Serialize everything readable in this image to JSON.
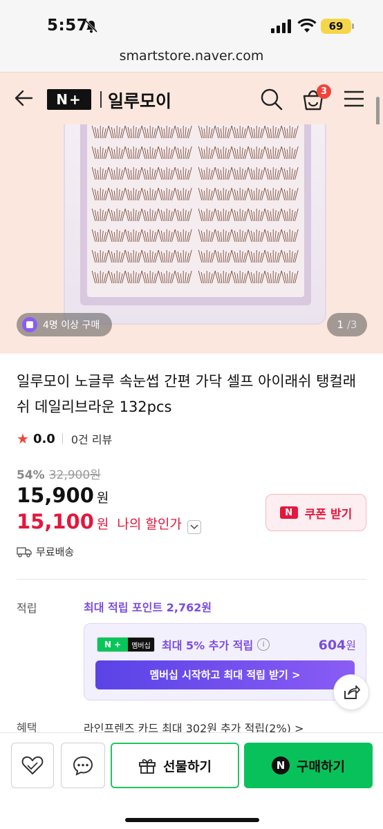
{
  "status": {
    "time": "5:57",
    "battery": "69"
  },
  "browser": {
    "url": "smartstore.naver.com"
  },
  "header": {
    "logo": "N+",
    "store_name": "일루모이",
    "cart_count": "3"
  },
  "gallery": {
    "buyers_badge": "4명 이상 구매",
    "page_current": "1",
    "page_total": "/3"
  },
  "product": {
    "title": "일루모이 노글루 속눈썹 간편 가닥 셀프 아이래쉬 탱컬래쉬 데일리브라운 132pcs",
    "rating": "0.0",
    "reviews": "0건 리뷰",
    "discount_pct": "54%",
    "original_price": "32,900원",
    "price": "15,900",
    "price_unit": "원",
    "my_price": "15,100",
    "my_price_unit": "원",
    "my_price_label": "나의 할인가",
    "coupon_badge": "N",
    "coupon_label": "쿠폰 받기",
    "shipping": "무료배송"
  },
  "points": {
    "label": "적립",
    "max_points": "최대 적립 포인트 2,762원",
    "membership_badge_left": "N +",
    "membership_badge_right": "멤버십",
    "extra_text": "최대 5% 추가 적립",
    "info_icon": "i",
    "extra_amount": "604",
    "extra_unit": "원",
    "cta": "멤버십 시작하고 최대 적립 받기 >"
  },
  "benefit": {
    "label": "혜택",
    "text": "라인프렌즈 카드 최대 302원 추가 적립(2%) >"
  },
  "bottom_bar": {
    "gift_label": "선물하기",
    "buy_logo": "N",
    "buy_label": "구매하기"
  },
  "colors": {
    "accent_red": "#e4173d",
    "naver_green": "#09c15a",
    "points_purple": "#7a4ddf",
    "header_bg": "#fbe7de"
  },
  "icons": [
    "bell-slash-icon",
    "signal-icon",
    "wifi-icon",
    "back-arrow-icon",
    "search-icon",
    "cart-icon",
    "menu-icon",
    "star-icon",
    "chevron-down-icon",
    "truck-icon",
    "share-icon",
    "heart-icon",
    "chat-icon",
    "gift-icon"
  ]
}
